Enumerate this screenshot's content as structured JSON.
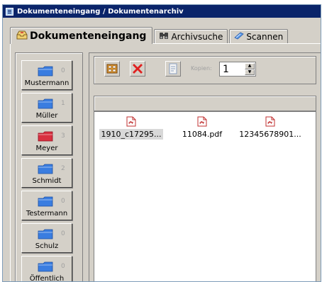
{
  "window": {
    "title": "Dokumenteneingang / Dokumentenarchiv"
  },
  "tabs": [
    {
      "label": "Dokumenteneingang",
      "icon": "inbox-icon",
      "active": true
    },
    {
      "label": "Archivsuche",
      "icon": "binoculars-icon",
      "active": false
    },
    {
      "label": "Scannen",
      "icon": "scanner-icon",
      "active": false
    }
  ],
  "users": [
    {
      "name": "Mustermann",
      "count": "0",
      "folder_color": "#3a7de0"
    },
    {
      "name": "Müller",
      "count": "1",
      "folder_color": "#3a7de0"
    },
    {
      "name": "Meyer",
      "count": "3",
      "folder_color": "#d83040"
    },
    {
      "name": "Schmidt",
      "count": "2",
      "folder_color": "#3a7de0"
    },
    {
      "name": "Testermann",
      "count": "0",
      "folder_color": "#3a7de0"
    },
    {
      "name": "Schulz",
      "count": "0",
      "folder_color": "#3a7de0"
    },
    {
      "name": "Öffentlich",
      "count": "0",
      "folder_color": "#3a7de0"
    }
  ],
  "toolbar": {
    "kopien_label": "Kopien:",
    "kopien_value": "1"
  },
  "files": [
    {
      "name": "1910_c17295...",
      "selected": true
    },
    {
      "name": "11084.pdf",
      "selected": false
    },
    {
      "name": "12345678901...",
      "selected": false
    }
  ]
}
